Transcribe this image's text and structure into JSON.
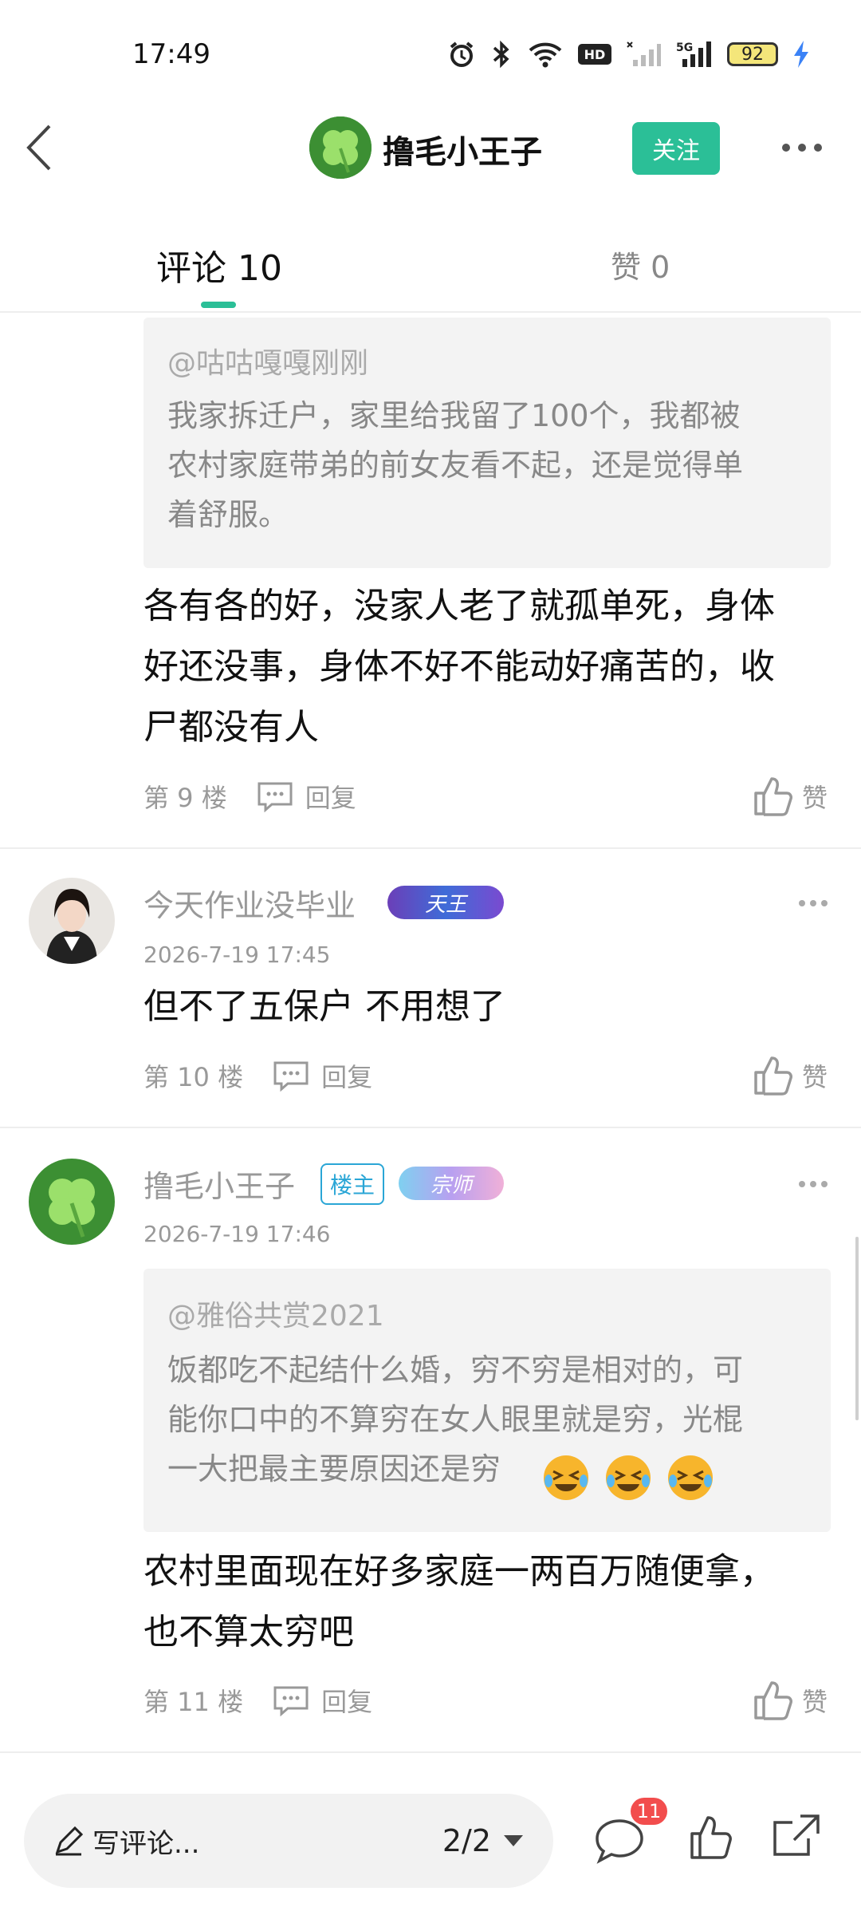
{
  "status_bar": {
    "time": "17:49",
    "battery": "92",
    "icons": [
      "alarm-icon",
      "bluetooth-icon",
      "wifi-icon",
      "hd-icon",
      "signal-icon",
      "5g-signal-icon",
      "battery-icon",
      "charging-icon"
    ]
  },
  "header": {
    "title": "撸毛小王子",
    "follow_label": "关注"
  },
  "tabs": {
    "comments": "评论 10",
    "likes": "赞 0"
  },
  "comments": [
    {
      "quote_user": "@咕咕嘎嘎刚刚",
      "quote_lines": [
        "我家拆迁户，家里给我留了100个，我都被",
        "农村家庭带弟的前女友看不起，还是觉得单",
        "着舒服。"
      ],
      "body_lines": [
        "各有各的好，没家人老了就孤单死，身体",
        "好还没事，身体不好不能动好痛苦的，收",
        "尸都没有人"
      ],
      "floor": "第 9 楼",
      "reply_label": "回复",
      "like_label": "赞"
    },
    {
      "user": "今天作业没毕业",
      "level_badge": "天王",
      "date": "2026-7-19 17:45",
      "body_lines": [
        "但不了五保户 不用想了"
      ],
      "floor": "第 10 楼",
      "reply_label": "回复",
      "like_label": "赞"
    },
    {
      "user": "撸毛小王子",
      "host_badge": "楼主",
      "level_badge": "宗师",
      "date": "2026-7-19 17:46",
      "quote_user": "@雅俗共赏2021",
      "quote_lines": [
        "饭都吃不起结什么婚，穷不穷是相对的，可",
        "能你口中的不算穷在女人眼里就是穷，光棍",
        "一大把最主要原因还是穷"
      ],
      "body_lines": [
        "农村里面现在好多家庭一两百万随便拿，",
        "也不算太穷吧"
      ],
      "floor": "第 11 楼",
      "reply_label": "回复",
      "like_label": "赞"
    }
  ],
  "bottom_bar": {
    "write_label": "写评论...",
    "page": "2/2",
    "comment_count": "11"
  },
  "colors": {
    "accent": "#2bbf97",
    "badge_red": "#f24d4d",
    "host_blue": "#2aa6d6"
  }
}
